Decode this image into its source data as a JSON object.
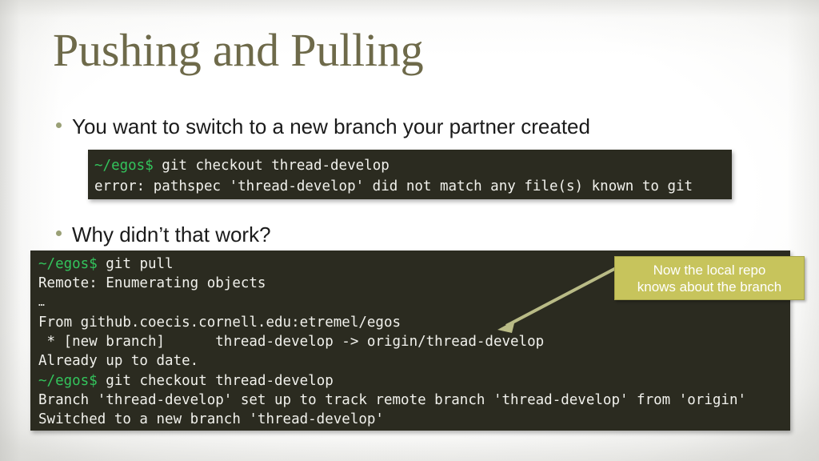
{
  "slide": {
    "title": "Pushing and Pulling",
    "bullets": [
      {
        "text": "You want to switch to a new branch your partner created"
      },
      {
        "text": "Why didn’t that work?"
      }
    ],
    "terminal_small": {
      "lines": [
        {
          "prompt": "~/egos$",
          "text": " git checkout thread-develop"
        },
        {
          "prompt": "",
          "text": "error: pathspec 'thread-develop' did not match any file(s) known to git"
        }
      ]
    },
    "terminal_big": {
      "lines": [
        {
          "prompt": "~/egos$",
          "text": " git pull"
        },
        {
          "prompt": "",
          "text": "Remote: Enumerating objects"
        },
        {
          "prompt": "",
          "text": "…"
        },
        {
          "prompt": "",
          "text": "From github.coecis.cornell.edu:etremel/egos"
        },
        {
          "prompt": "",
          "text": " * [new branch]      thread-develop -> origin/thread-develop"
        },
        {
          "prompt": "",
          "text": "Already up to date."
        },
        {
          "prompt": "~/egos$",
          "text": " git checkout thread-develop"
        },
        {
          "prompt": "",
          "text": "Branch 'thread-develop' set up to track remote branch 'thread-develop' from 'origin'"
        },
        {
          "prompt": "",
          "text": "Switched to a new branch 'thread-develop'"
        }
      ]
    },
    "callout": {
      "line1": "Now the local repo",
      "line2": "knows about the branch"
    },
    "colors": {
      "title": "#6e6a4a",
      "bullet_dot": "#9aa076",
      "terminal_bg": "#2b2b20",
      "terminal_fg": "#f1f1ec",
      "prompt_green": "#33c45c",
      "callout_bg": "#c7c45c",
      "callout_border": "#a9a64a",
      "arrow": "#b9bb86",
      "slide_bg": "#ffffff"
    }
  }
}
